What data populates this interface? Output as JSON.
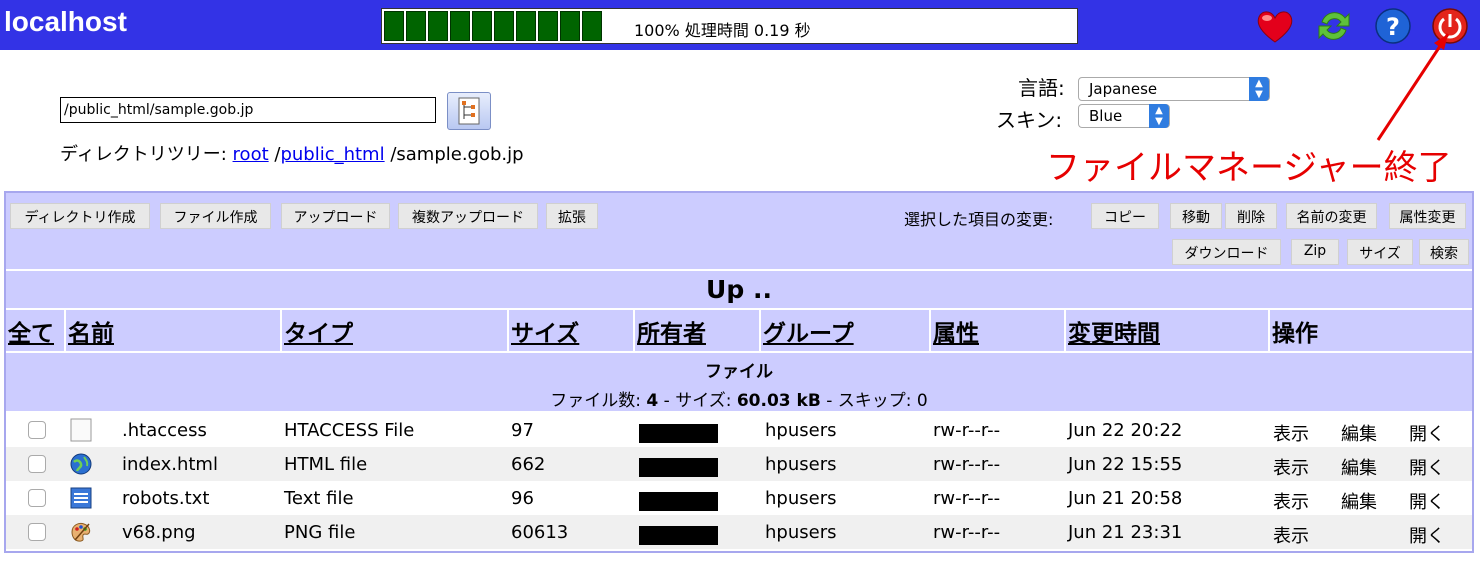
{
  "header": {
    "title": "localhost",
    "progress_text": "100% 処理時間 0.19 秒",
    "progress_percent": 100,
    "icons": [
      "heart-icon",
      "refresh-icon",
      "help-icon",
      "power-icon"
    ]
  },
  "path": {
    "value": "/public_html/sample.gob.jp",
    "dirtree_label": "ディレクトリツリー:",
    "root_link": "root",
    "sep1": " /",
    "public_link": "public_html",
    "current": " /sample.gob.jp"
  },
  "settings": {
    "language_label": "言語:",
    "language_value": "Japanese",
    "skin_label": "スキン:",
    "skin_value": "Blue"
  },
  "annotation": {
    "text": "ファイルマネージャー終了",
    "color": "#e60000"
  },
  "toolbar": {
    "left_buttons": [
      "ディレクトリ作成",
      "ファイル作成",
      "アップロード",
      "複数アップロード",
      "拡張"
    ],
    "change_label": "選択した項目の変更:",
    "right_buttons_row1": [
      "コピー",
      "移動",
      "削除",
      "名前の変更",
      "属性変更"
    ],
    "right_buttons_row2": [
      "ダウンロード",
      "Zip",
      "サイズ",
      "検索"
    ]
  },
  "up_label": "Up ..",
  "columns": [
    "全て",
    "名前",
    "タイプ",
    "サイズ",
    "所有者",
    "グループ",
    "属性",
    "変更時間",
    "操作"
  ],
  "files_section": {
    "title": "ファイル",
    "count_label": "ファイル数: ",
    "count": "4",
    "size_label": " - サイズ: ",
    "size": "60.03 kB",
    "skip_label": " - スキップ: 0"
  },
  "files": [
    {
      "icon": "htaccess-file-icon",
      "name": ".htaccess",
      "type": "HTACCESS File",
      "size": "97",
      "group": "hpusers",
      "perms": "rw-r--r--",
      "mtime": "Jun 22 20:22",
      "view": "表示",
      "edit": "編集",
      "open": "開く"
    },
    {
      "icon": "html-globe-icon",
      "name": "index.html",
      "type": "HTML file",
      "size": "662",
      "group": "hpusers",
      "perms": "rw-r--r--",
      "mtime": "Jun 22 15:55",
      "view": "表示",
      "edit": "編集",
      "open": "開く"
    },
    {
      "icon": "text-file-icon",
      "name": "robots.txt",
      "type": "Text file",
      "size": "96",
      "group": "hpusers",
      "perms": "rw-r--r--",
      "mtime": "Jun 21 20:58",
      "view": "表示",
      "edit": "編集",
      "open": "開く"
    },
    {
      "icon": "image-palette-icon",
      "name": "v68.png",
      "type": "PNG file",
      "size": "60613",
      "group": "hpusers",
      "perms": "rw-r--r--",
      "mtime": "Jun 21 23:31",
      "view": "表示",
      "edit": "",
      "open": "開く"
    }
  ]
}
